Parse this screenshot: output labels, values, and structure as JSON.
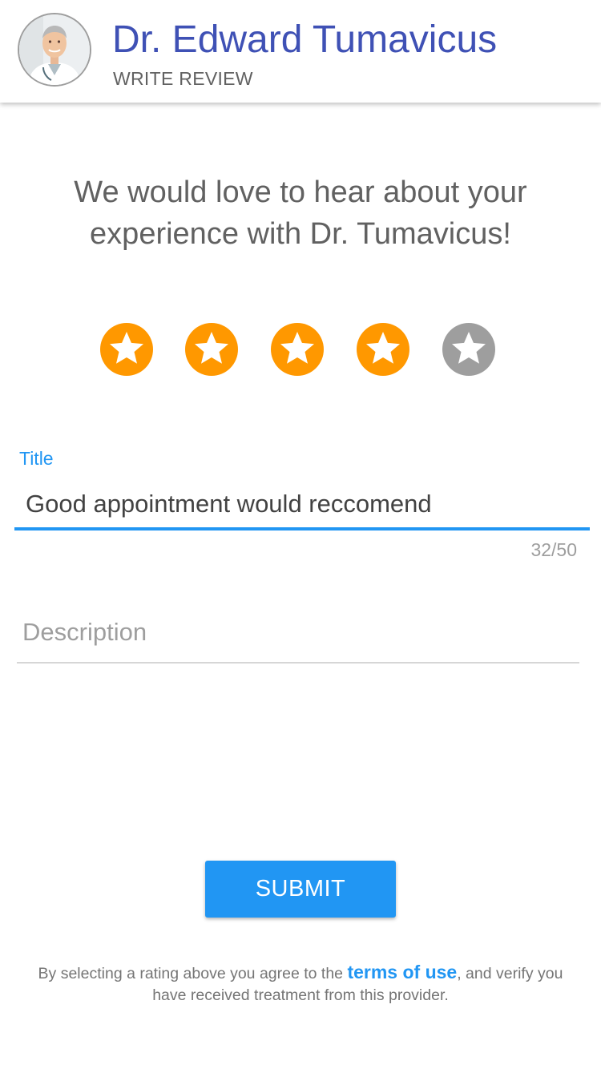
{
  "header": {
    "doctor_name": "Dr. Edward Tumavicus",
    "subtitle": "WRITE REVIEW",
    "accent_color": "#3f51b5"
  },
  "prompt": {
    "line1": "We would love to hear about your",
    "line2": "experience with Dr. Tumavicus!"
  },
  "rating": {
    "value": 4,
    "max": 5,
    "icon": "star-icon",
    "filled_color": "#ff9800",
    "empty_color": "#9e9e9e"
  },
  "form": {
    "title_label": "Title",
    "title_value": "Good appointment would reccomend",
    "title_counter": "32/50",
    "description_placeholder": "Description",
    "description_value": "",
    "submit_label": "SUBMIT",
    "primary_color": "#2196f3"
  },
  "legal": {
    "text_before": "By selecting a rating above you agree to the ",
    "link_text": "terms of use",
    "text_after": ", and verify you have received treatment from this provider."
  }
}
